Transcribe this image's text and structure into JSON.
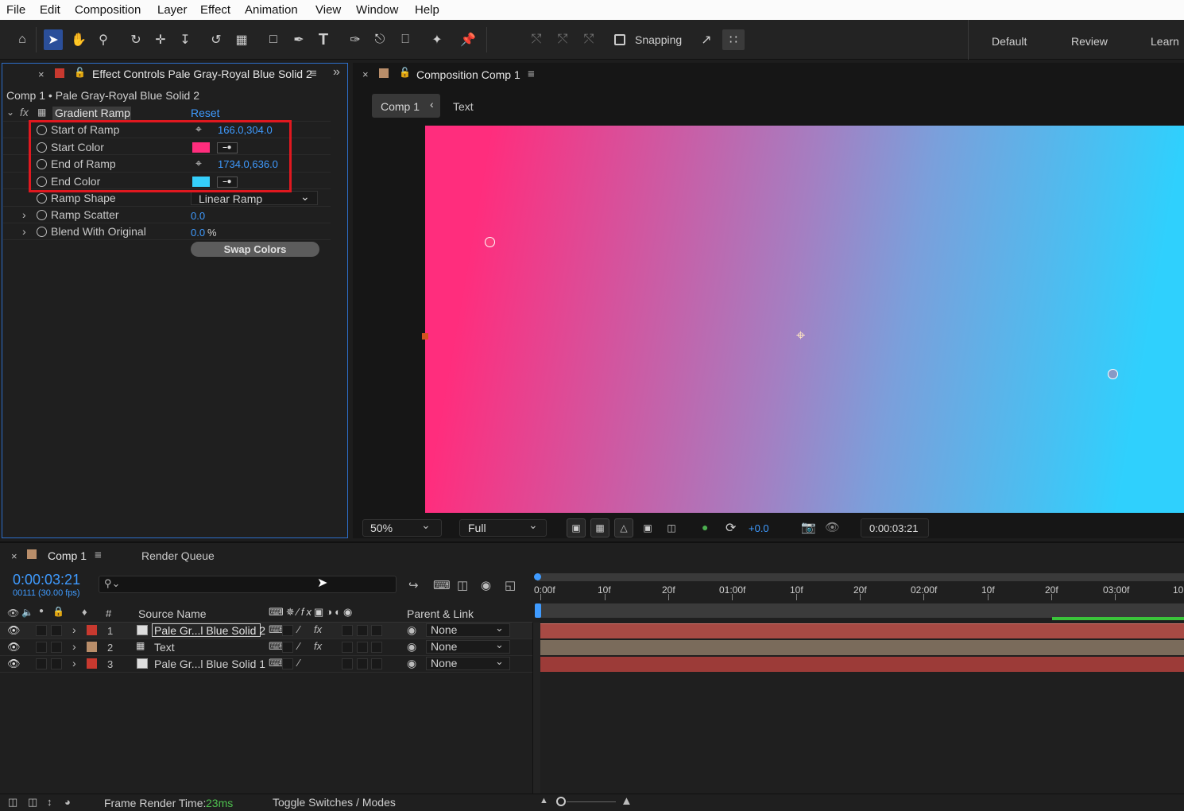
{
  "menu": {
    "items": [
      "File",
      "Edit",
      "Composition",
      "Layer",
      "Effect",
      "Animation",
      "View",
      "Window",
      "Help"
    ]
  },
  "toolbar": {
    "tools": [
      "home-icon",
      "selection-tool-icon",
      "hand-tool-icon",
      "zoom-tool-icon",
      "orbit-camera-icon",
      "pan-camera-icon",
      "dolly-camera-icon",
      "rotate-tool-icon",
      "pan-behind-icon",
      "rectangle-tool-icon",
      "pen-tool-icon",
      "type-tool-icon",
      "brush-tool-icon",
      "clone-stamp-icon",
      "eraser-icon",
      "roto-brush-icon",
      "puppet-pin-icon"
    ],
    "snapping_label": "Snapping",
    "workspaces": [
      "Default",
      "Review",
      "Learn"
    ]
  },
  "effect_controls": {
    "tab_title": "Effect Controls Pale Gray-Royal Blue Solid 2",
    "subtitle": "Comp 1 • Pale Gray-Royal Blue Solid 2",
    "effect_name": "Gradient Ramp",
    "reset": "Reset",
    "fx": "fx",
    "properties": [
      {
        "name": "Start of Ramp",
        "value": "166.0,304.0"
      },
      {
        "name": "Start Color",
        "color": "#ff2d7d"
      },
      {
        "name": "End of Ramp",
        "value": "1734.0,636.0"
      },
      {
        "name": "End Color",
        "color": "#35cffb"
      },
      {
        "name": "Ramp Shape",
        "value": "Linear Ramp"
      },
      {
        "name": "Ramp Scatter",
        "value": "0.0"
      },
      {
        "name": "Blend With Original",
        "value": "0.0",
        "unit": "%"
      }
    ],
    "swap_button": "Swap Colors",
    "highlight_color": "#e0181f"
  },
  "composition": {
    "tab_title": "Composition Comp 1",
    "breadcrumb": [
      "Comp 1",
      "Text"
    ],
    "gradient": {
      "start": "#ff2d7d",
      "end": "#2fd0fd"
    },
    "zoom": "50%",
    "resolution": "Full",
    "exposure": "+0.0",
    "timecode": "0:00:03:21"
  },
  "timeline": {
    "tab_comp": "Comp 1",
    "tab_render": "Render Queue",
    "current_time": "0:00:03:21",
    "frame_info": "00111 (30.00 fps)",
    "search_placeholder": "",
    "ruler": [
      "0:00f",
      "10f",
      "20f",
      "01:00f",
      "10f",
      "20f",
      "02:00f",
      "10f",
      "20f",
      "03:00f",
      "10"
    ],
    "col_num": "#",
    "col_source": "Source Name",
    "col_parent": "Parent & Link",
    "layers": [
      {
        "num": "1",
        "name": "Pale Gr...l Blue Solid 2",
        "label_color": "#c8392f",
        "parent": "None",
        "fx": "fx",
        "selected": true
      },
      {
        "num": "2",
        "name": "Text",
        "label_color": "#b98e6a",
        "parent": "None",
        "fx": "fx",
        "selected": false
      },
      {
        "num": "3",
        "name": "Pale Gr...l Blue Solid 1",
        "label_color": "#c8392f",
        "parent": "None",
        "fx": "",
        "selected": false
      }
    ],
    "bar_colors": [
      "#a84a44",
      "#7a6b5b",
      "#9c3b38"
    ]
  },
  "status": {
    "render_label": "Frame Render Time:",
    "render_value": "23ms",
    "toggle": "Toggle Switches / Modes"
  }
}
